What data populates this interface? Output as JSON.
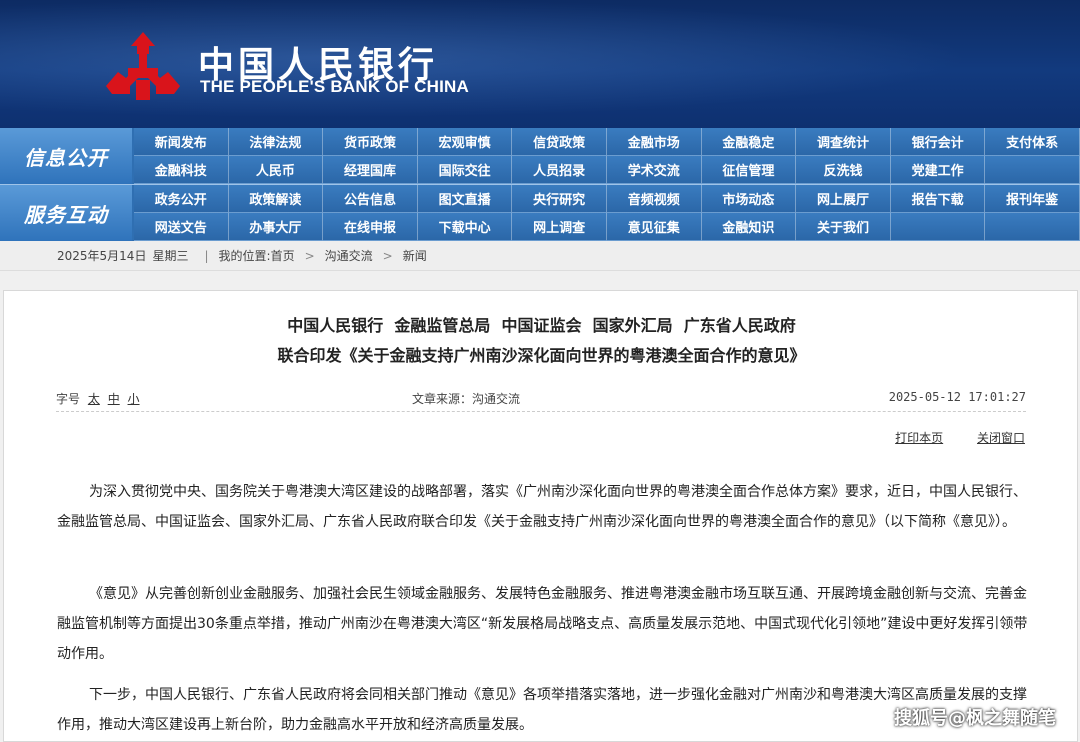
{
  "header": {
    "title_cn": "中国人民银行",
    "title_en": "THE PEOPLE'S BANK OF CHINA",
    "emblem_color": "#d9141b",
    "bg_color": "#123a7e"
  },
  "nav": {
    "group1_label": "信息公开",
    "group2_label": "服务互动",
    "group1_row1": [
      "新闻发布",
      "法律法规",
      "货币政策",
      "宏观审慎",
      "信贷政策",
      "金融市场",
      "金融稳定",
      "调查统计",
      "银行会计",
      "支付体系"
    ],
    "group1_row2": [
      "金融科技",
      "人民币",
      "经理国库",
      "国际交往",
      "人员招录",
      "学术交流",
      "征信管理",
      "反洗钱",
      "党建工作",
      ""
    ],
    "group2_row1": [
      "政务公开",
      "政策解读",
      "公告信息",
      "图文直播",
      "央行研究",
      "音频视频",
      "市场动态",
      "网上展厅",
      "报告下载",
      "报刊年鉴"
    ],
    "group2_row2": [
      "网送文告",
      "办事大厅",
      "在线申报",
      "下载中心",
      "网上调查",
      "意见征集",
      "金融知识",
      "关于我们",
      "",
      ""
    ]
  },
  "breadcrumb": {
    "date": "2025年5月14日",
    "weekday": "星期三",
    "divider": "|",
    "location_label": "我的位置:",
    "home": "首页",
    "arrow": ">",
    "section": "沟通交流",
    "current": "新闻"
  },
  "article": {
    "title_line1": "中国人民银行  金融监管总局  中国证监会  国家外汇局  广东省人民政府",
    "title_line2": "联合印发《关于金融支持广州南沙深化面向世界的粤港澳全面合作的意见》",
    "font_size_label": "字号",
    "font_large": "太",
    "font_medium": "中",
    "font_small": "小",
    "source": "文章来源：沟通交流",
    "datetime": "2025-05-12 17:01:27",
    "print_label": "打印本页",
    "close_label": "关闭窗口",
    "paragraphs": [
      "为深入贯彻党中央、国务院关于粤港澳大湾区建设的战略部署，落实《广州南沙深化面向世界的粤港澳全面合作总体方案》要求，近日，中国人民银行、金融监管总局、中国证监会、国家外汇局、广东省人民政府联合印发《关于金融支持广州南沙深化面向世界的粤港澳全面合作的意见》（以下简称《意见》）。",
      "《意见》从完善创新创业金融服务、加强社会民生领域金融服务、发展特色金融服务、推进粤港澳金融市场互联互通、开展跨境金融创新与交流、完善金融监管机制等方面提出30条重点举措，推动广州南沙在粤港澳大湾区“新发展格局战略支点、高质量发展示范地、中国式现代化引领地”建设中更好发挥引领带动作用。",
      "下一步，中国人民银行、广东省人民政府将会同相关部门推动《意见》各项举措落实落地，进一步强化金融对广州南沙和粤港澳大湾区高质量发展的支撑作用，推动大湾区建设再上新台阶，助力金融高水平开放和经济高质量发展。"
    ]
  },
  "watermark": "搜狐号@枫之舞随笔"
}
